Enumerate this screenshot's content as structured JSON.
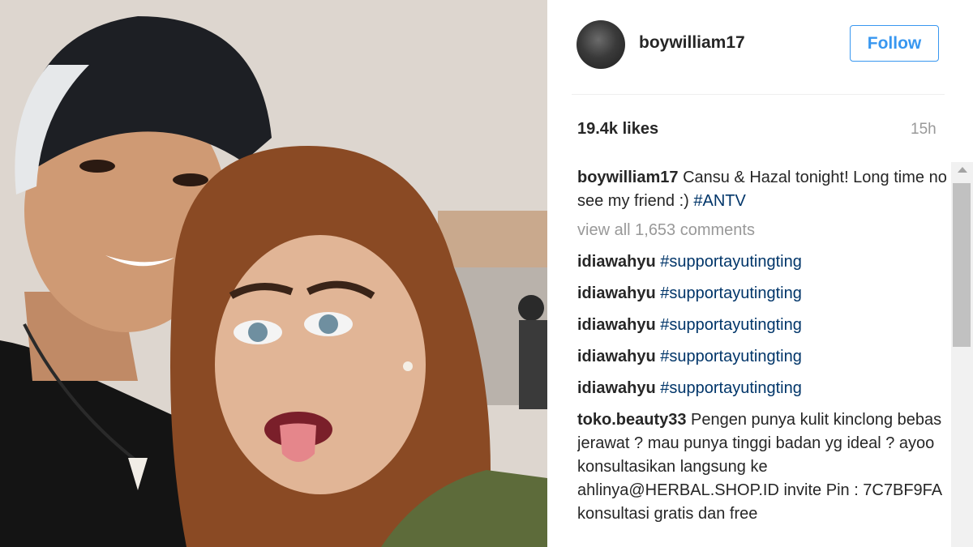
{
  "post": {
    "username": "boywilliam17",
    "follow_label": "Follow",
    "likes": "19.4k likes",
    "time_ago": "15h"
  },
  "caption": {
    "user": "boywilliam17",
    "text": "Cansu & Hazal tonight! Long time no see my friend :) ",
    "hashtag": "#ANTV"
  },
  "view_all_label": "view all 1,653 comments",
  "comments": [
    {
      "user": "idiawahyu",
      "hashtag": "#supportayutingting"
    },
    {
      "user": "idiawahyu",
      "hashtag": "#supportayutingting"
    },
    {
      "user": "idiawahyu",
      "hashtag": "#supportayutingting"
    },
    {
      "user": "idiawahyu",
      "hashtag": "#supportayutingting"
    },
    {
      "user": "idiawahyu",
      "hashtag": "#supportayutingting"
    }
  ],
  "long_comment": {
    "user": "toko.beauty33",
    "text": "Pengen punya kulit kinclong bebas jerawat ? mau punya tinggi badan yg ideal ? ayoo konsultasikan langsung ke ahlinya@HERBAL.SHOP.ID invite Pin : 7C7BF9FA konsultasi gratis dan free"
  },
  "colors": {
    "accent": "#3897f0",
    "hashtag": "#003569",
    "muted": "#999999",
    "text": "#262626"
  },
  "icons": {
    "scroll_up": "scroll-up-arrow-icon"
  }
}
